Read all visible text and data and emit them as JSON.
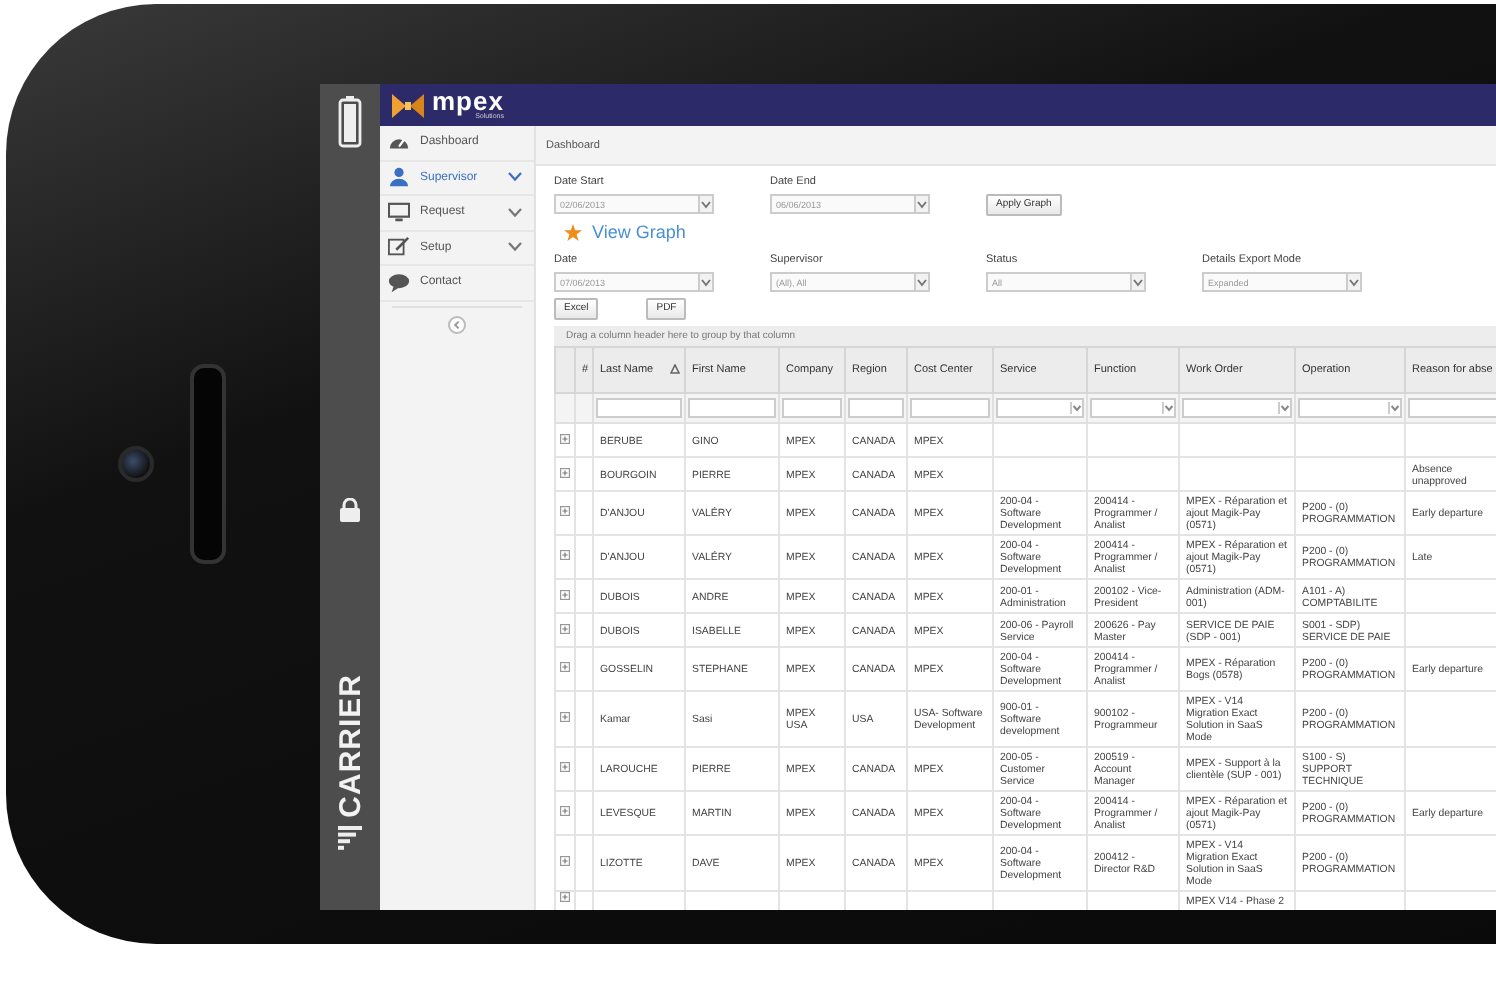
{
  "status_bar": {
    "carrier": "CARRIER"
  },
  "app": {
    "logo": "mpex",
    "logo_tagline": "Solutions"
  },
  "sidebar": {
    "items": [
      {
        "label": "Dashboard",
        "selected": false,
        "expandable": false
      },
      {
        "label": "Supervisor",
        "selected": true,
        "expandable": true
      },
      {
        "label": "Request",
        "selected": false,
        "expandable": true
      },
      {
        "label": "Setup",
        "selected": false,
        "expandable": true
      },
      {
        "label": "Contact",
        "selected": false,
        "expandable": false
      }
    ]
  },
  "breadcrumb": "Dashboard",
  "graph_filters": [
    {
      "label": "Date Start",
      "value": "02/06/2013"
    },
    {
      "label": "Date End",
      "value": "06/06/2013"
    }
  ],
  "apply_button": "Apply Graph",
  "view_graph_link": "View Graph",
  "filters": [
    {
      "label": "Date",
      "value": "07/06/2013"
    },
    {
      "label": "Supervisor",
      "value": "(All), All"
    },
    {
      "label": "Status",
      "value": "All"
    },
    {
      "label": "Details Export Mode",
      "value": "Expanded"
    }
  ],
  "export_buttons": [
    "Excel",
    "PDF"
  ],
  "group_panel": "Drag a column header here to group by that column",
  "table": {
    "columns": [
      {
        "label": "#",
        "sorted": false,
        "kind": "none"
      },
      {
        "label": "Last Name",
        "sorted": true,
        "kind": "text"
      },
      {
        "label": "First Name",
        "sorted": false,
        "kind": "text"
      },
      {
        "label": "Company",
        "sorted": false,
        "kind": "text"
      },
      {
        "label": "Region",
        "sorted": false,
        "kind": "text"
      },
      {
        "label": "Cost Center",
        "sorted": false,
        "kind": "text"
      },
      {
        "label": "Service",
        "sorted": false,
        "kind": "dropdown"
      },
      {
        "label": "Function",
        "sorted": false,
        "kind": "dropdown"
      },
      {
        "label": "Work Order",
        "sorted": false,
        "kind": "dropdown"
      },
      {
        "label": "Operation",
        "sorted": false,
        "kind": "dropdown"
      },
      {
        "label": "Reason for abse",
        "sorted": false,
        "kind": "text"
      }
    ],
    "rows": [
      {
        "last_name": "BERUBE",
        "first_name": "GINO",
        "company": "MPEX",
        "region": "CANADA",
        "cost_center": "MPEX"
      },
      {
        "last_name": "BOURGOIN",
        "first_name": "PIERRE",
        "company": "MPEX",
        "region": "CANADA",
        "cost_center": "MPEX",
        "reason": "Absence unapproved"
      },
      {
        "last_name": "D'ANJOU",
        "first_name": "VALÉRY",
        "company": "MPEX",
        "region": "CANADA",
        "cost_center": "MPEX",
        "service": "200-04 - Software Development",
        "function": "200414 - Programmer / Analist",
        "work_order": "MPEX - Réparation et ajout Magik-Pay (0571)",
        "operation": "P200 - (0) PROGRAMMATION",
        "reason": "Early departure"
      },
      {
        "last_name": "D'ANJOU",
        "first_name": "VALÉRY",
        "company": "MPEX",
        "region": "CANADA",
        "cost_center": "MPEX",
        "service": "200-04 - Software Development",
        "function": "200414 - Programmer / Analist",
        "work_order": "MPEX - Réparation et ajout Magik-Pay (0571)",
        "operation": "P200 - (0) PROGRAMMATION",
        "reason": "Late"
      },
      {
        "last_name": "DUBOIS",
        "first_name": "ANDRE",
        "company": "MPEX",
        "region": "CANADA",
        "cost_center": "MPEX",
        "service": "200-01 - Administration",
        "function": "200102 - Vice-President",
        "work_order": "Administration (ADM-001)",
        "operation": "A101 - A) COMPTABILITE"
      },
      {
        "last_name": "DUBOIS",
        "first_name": "ISABELLE",
        "company": "MPEX",
        "region": "CANADA",
        "cost_center": "MPEX",
        "service": "200-06 - Payroll Service",
        "function": "200626 - Pay Master",
        "work_order": "SERVICE DE PAIE (SDP - 001)",
        "operation": "S001 - SDP) SERVICE DE PAIE"
      },
      {
        "last_name": "GOSSELIN",
        "first_name": "STEPHANE",
        "company": "MPEX",
        "region": "CANADA",
        "cost_center": "MPEX",
        "service": "200-04 - Software Development",
        "function": "200414 - Programmer / Analist",
        "work_order": "MPEX - Réparation Bogs (0578)",
        "operation": "P200 - (0) PROGRAMMATION",
        "reason": "Early departure"
      },
      {
        "last_name": "Kamar",
        "first_name": "Sasi",
        "company": "MPEX USA",
        "region": "USA",
        "cost_center": "USA- Software Development",
        "service": "900-01 - Software development",
        "function": "900102 - Programmeur",
        "work_order": "MPEX - V14 Migration Exact Solution in SaaS Mode",
        "operation": "P200 - (0) PROGRAMMATION"
      },
      {
        "last_name": "LAROUCHE",
        "first_name": "PIERRE",
        "company": "MPEX",
        "region": "CANADA",
        "cost_center": "MPEX",
        "service": "200-05 - Customer Service",
        "function": "200519 - Account Manager",
        "work_order": "MPEX - Support à la clientèle (SUP - 001)",
        "operation": "S100 - S) SUPPORT TECHNIQUE"
      },
      {
        "last_name": "LEVESQUE",
        "first_name": "MARTIN",
        "company": "MPEX",
        "region": "CANADA",
        "cost_center": "MPEX",
        "service": "200-04 - Software Development",
        "function": "200414 - Programmer / Analist",
        "work_order": "MPEX - Réparation et ajout Magik-Pay (0571)",
        "operation": "P200 - (0) PROGRAMMATION",
        "reason": "Early departure"
      },
      {
        "last_name": "LIZOTTE",
        "first_name": "DAVE",
        "company": "MPEX",
        "region": "CANADA",
        "cost_center": "MPEX",
        "service": "200-04 - Software Development",
        "function": "200412 - Director R&D",
        "work_order": "MPEX - V14 Migration Exact Solution in SaaS Mode",
        "operation": "P200 - (0) PROGRAMMATION"
      },
      {
        "work_order": "MPEX V14 - Phase 2"
      }
    ]
  }
}
